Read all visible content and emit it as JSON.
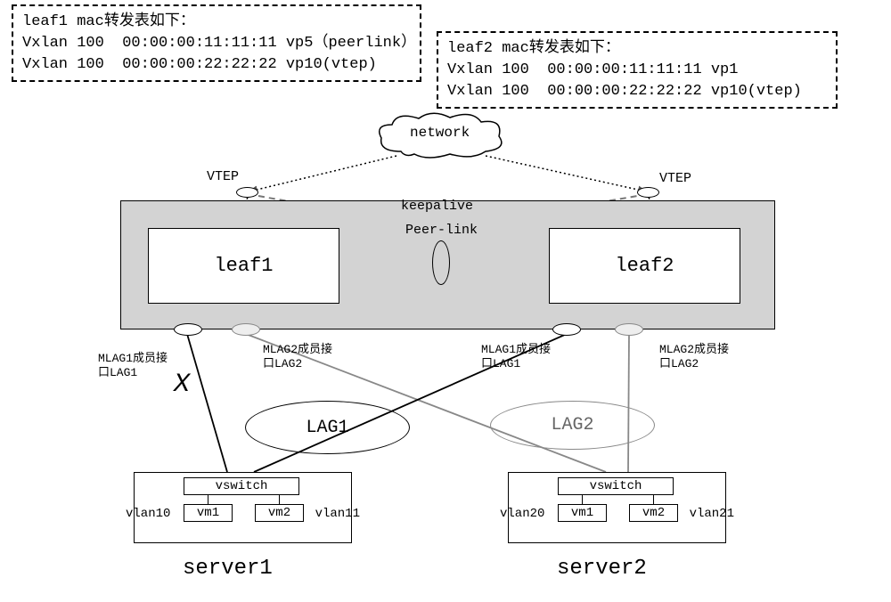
{
  "mac_tables": {
    "leaf1": {
      "title": "leaf1 mac转发表如下：",
      "row1": "Vxlan 100  00:00:00:11:11:11 vp5（peerlink）",
      "row2": "Vxlan 100  00:00:00:22:22:22 vp10(vtep)"
    },
    "leaf2": {
      "title": "leaf2 mac转发表如下：",
      "row1": "Vxlan 100  00:00:00:11:11:11 vp1",
      "row2": "Vxlan 100  00:00:00:22:22:22 vp10(vtep)"
    }
  },
  "labels": {
    "network": "network",
    "vtep": "VTEP",
    "keepalive": "keepalive",
    "peerlink": "Peer-link"
  },
  "leaves": {
    "leaf1": "leaf1",
    "leaf2": "leaf2"
  },
  "mlag": {
    "l1": "MLAG1成员接口LAG1",
    "l2": "MLAG2成员接口LAG2",
    "r1": "MLAG1成员接口LAG1",
    "r2": "MLAG2成员接口LAG2"
  },
  "fail_mark": "X",
  "lag": {
    "lag1": "LAG1",
    "lag2": "LAG2"
  },
  "servers": {
    "vswitch": "vswitch",
    "vm1": "vm1",
    "vm2": "vm2",
    "s1": {
      "name": "server1",
      "vlan_l": "vlan10",
      "vlan_r": "vlan11"
    },
    "s2": {
      "name": "server2",
      "vlan_l": "vlan20",
      "vlan_r": "vlan21"
    }
  }
}
